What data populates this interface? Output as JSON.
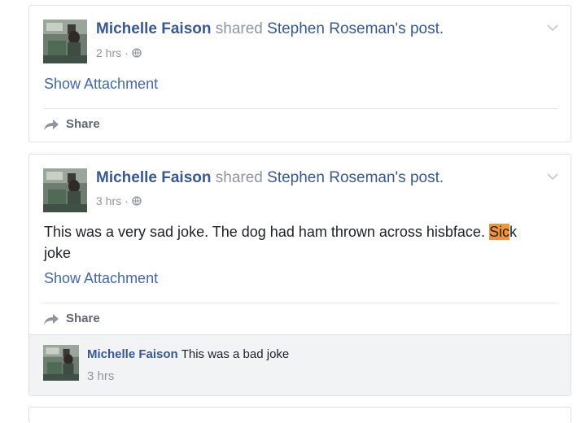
{
  "posts": [
    {
      "author": "Michelle Faison",
      "action": "shared",
      "target": "Stephen Roseman",
      "target_suffix": "'s post.",
      "time": "2 hrs",
      "sep": "·",
      "attachment_label": "Show Attachment",
      "share_label": "Share"
    },
    {
      "author": "Michelle Faison",
      "action": "shared",
      "target": "Stephen Roseman",
      "target_suffix": "'s post.",
      "time": "3 hrs",
      "sep": "·",
      "text_before": "This was a very sad joke. The dog had ham thrown across hisbface. ",
      "text_highlight": "Sic",
      "text_after": "k joke",
      "attachment_label": "Show Attachment",
      "share_label": "Share",
      "comment": {
        "author": "Michelle Faison",
        "text": "This was a bad joke",
        "time": "3 hrs"
      }
    }
  ],
  "icons": {
    "globe": "globe-icon",
    "chevron": "chevron-down-icon",
    "share": "share-arrow-icon"
  },
  "colors": {
    "link": "#365899",
    "highlight": "#f29334",
    "muted": "#90949c"
  }
}
